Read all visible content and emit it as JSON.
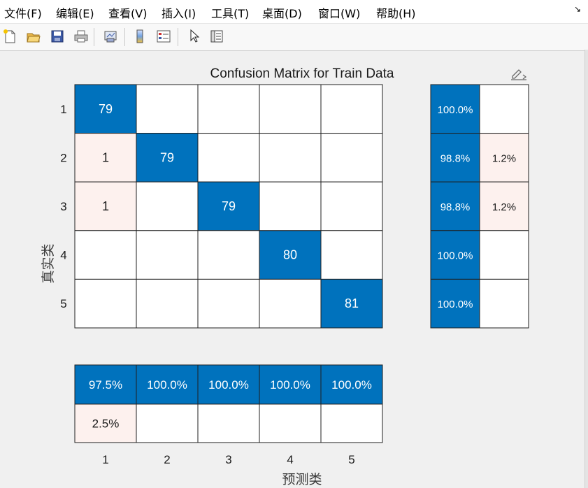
{
  "menubar": {
    "items": [
      "文件(F)",
      "编辑(E)",
      "查看(V)",
      "插入(I)",
      "工具(T)",
      "桌面(D)",
      "窗口(W)",
      "帮助(H)"
    ],
    "corner_icon": "dock-arrow-icon"
  },
  "toolbar": {
    "icons": [
      "new-figure-icon",
      "open-file-icon",
      "save-icon",
      "print-icon",
      "link-plot-icon",
      "colorbar-icon",
      "legend-icon",
      "edit-plot-arrow-icon",
      "property-inspector-icon"
    ]
  },
  "colors": {
    "accent": "#0072bd",
    "error_tint": "#fdf1ee",
    "empty": "#ffffff"
  },
  "chart_data": {
    "type": "heatmap",
    "title": "Confusion Matrix for Train Data",
    "xlabel": "预测类",
    "ylabel": "真实类",
    "classes": [
      "1",
      "2",
      "3",
      "4",
      "5"
    ],
    "matrix": [
      [
        79,
        null,
        null,
        null,
        null
      ],
      [
        1,
        79,
        null,
        null,
        null
      ],
      [
        1,
        null,
        79,
        null,
        null
      ],
      [
        null,
        null,
        null,
        80,
        null
      ],
      [
        null,
        null,
        null,
        null,
        81
      ]
    ],
    "row_summary": [
      [
        "100.0%",
        null
      ],
      [
        "98.8%",
        "1.2%"
      ],
      [
        "98.8%",
        "1.2%"
      ],
      [
        "100.0%",
        null
      ],
      [
        "100.0%",
        null
      ]
    ],
    "column_summary": {
      "correct": [
        "97.5%",
        "100.0%",
        "100.0%",
        "100.0%",
        "100.0%"
      ],
      "incorrect": [
        "2.5%",
        null,
        null,
        null,
        null
      ]
    }
  }
}
